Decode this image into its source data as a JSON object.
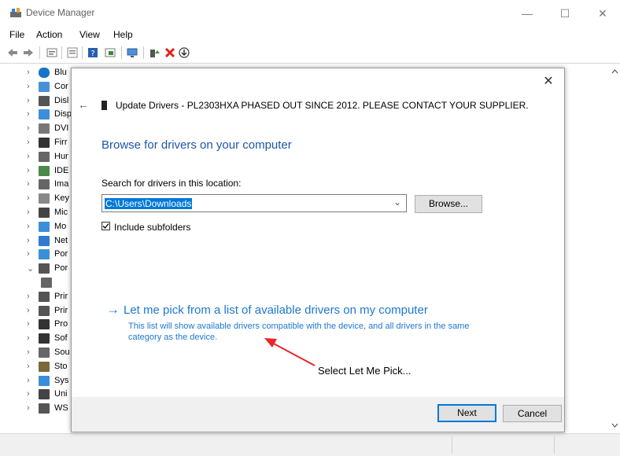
{
  "window": {
    "title": "Device Manager",
    "controls": {
      "minimize": "—",
      "maximize": "☐",
      "close": "✕"
    }
  },
  "menu": [
    "File",
    "Action",
    "View",
    "Help"
  ],
  "toolbar_icons": [
    "back-icon",
    "forward-icon",
    "properties-icon",
    "device-list-icon",
    "help-icon",
    "view-icon",
    "monitor-icon",
    "enable-device-icon",
    "uninstall-icon",
    "update-driver-icon"
  ],
  "tree": [
    {
      "chev": "›",
      "label": "Blu",
      "icon": "bluetooth-icon"
    },
    {
      "chev": "›",
      "label": "Cor",
      "icon": "computer-icon"
    },
    {
      "chev": "›",
      "label": "Disl",
      "icon": "disk-icon"
    },
    {
      "chev": "›",
      "label": "Disp",
      "icon": "display-icon"
    },
    {
      "chev": "›",
      "label": "DVI",
      "icon": "dvd-icon"
    },
    {
      "chev": "›",
      "label": "Firr",
      "icon": "firmware-icon"
    },
    {
      "chev": "›",
      "label": "Hur",
      "icon": "hid-icon"
    },
    {
      "chev": "›",
      "label": "IDE",
      "icon": "ide-icon"
    },
    {
      "chev": "›",
      "label": "Ima",
      "icon": "imaging-icon"
    },
    {
      "chev": "›",
      "label": "Key",
      "icon": "keyboard-icon"
    },
    {
      "chev": "›",
      "label": "Mic",
      "icon": "mouse-icon"
    },
    {
      "chev": "›",
      "label": "Mo",
      "icon": "monitor-icon"
    },
    {
      "chev": "›",
      "label": "Net",
      "icon": "network-icon"
    },
    {
      "chev": "›",
      "label": "Por",
      "icon": "portable-icon"
    },
    {
      "chev": "⌄",
      "label": "Por",
      "icon": "port-icon"
    },
    {
      "chev": "",
      "label": "",
      "icon": "port-device-icon"
    },
    {
      "chev": "›",
      "label": "Prir",
      "icon": "printer-icon"
    },
    {
      "chev": "›",
      "label": "Prir",
      "icon": "print-queue-icon"
    },
    {
      "chev": "›",
      "label": "Pro",
      "icon": "processor-icon"
    },
    {
      "chev": "›",
      "label": "Sof",
      "icon": "software-icon"
    },
    {
      "chev": "›",
      "label": "Sou",
      "icon": "sound-icon"
    },
    {
      "chev": "›",
      "label": "Sto",
      "icon": "storage-icon"
    },
    {
      "chev": "›",
      "label": "Sys",
      "icon": "system-icon"
    },
    {
      "chev": "›",
      "label": "Uni",
      "icon": "usb-icon"
    },
    {
      "chev": "›",
      "label": "WS",
      "icon": "wsd-icon"
    }
  ],
  "dialog": {
    "close": "✕",
    "back": "←",
    "title": "Update Drivers - PL2303HXA PHASED OUT SINCE 2012. PLEASE CONTACT YOUR SUPPLIER.",
    "heading": "Browse for drivers on your computer",
    "search_label": "Search for drivers in this location:",
    "path_value": "C:\\Users\\Downloads",
    "browse_label": "Browse...",
    "include_subfolders_label": "Include subfolders",
    "include_subfolders_checked": true,
    "pick_arrow": "→",
    "pick_link": "Let me pick from a list of available drivers on my computer",
    "pick_desc": "This list will show available drivers compatible with the device, and all drivers in the same category as the device.",
    "next_label": "Next",
    "cancel_label": "Cancel"
  },
  "annotation": {
    "text": "Select Let Me Pick...",
    "arrow_color": "#e8262b"
  },
  "colors": {
    "accent": "#0078d7",
    "link": "#1e78d0",
    "heading": "#1e56a8"
  }
}
